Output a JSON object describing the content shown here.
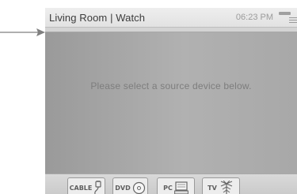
{
  "header": {
    "title": "Living Room | Watch",
    "time": "06:23 PM"
  },
  "main": {
    "message": "Please select a source device below."
  },
  "sources": [
    {
      "label": "CABLE",
      "icon": "cable-plug-icon"
    },
    {
      "label": "DVD",
      "icon": "disc-icon"
    },
    {
      "label": "PC",
      "icon": "computer-icon"
    },
    {
      "label": "TV",
      "icon": "antenna-icon"
    }
  ],
  "colors": {
    "titlebar": "#e8e8e8",
    "content": "#a8a8a8",
    "message_text": "#7d7d7d",
    "button": "#ededed"
  }
}
